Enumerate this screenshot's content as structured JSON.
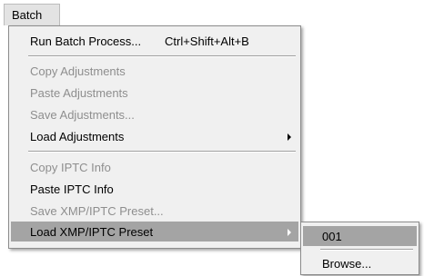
{
  "menubar": {
    "batch_label": "Batch"
  },
  "menu": {
    "run_batch_label": "Run Batch Process...",
    "run_batch_shortcut": "Ctrl+Shift+Alt+B",
    "copy_adjustments_label": "Copy Adjustments",
    "paste_adjustments_label": "Paste Adjustments",
    "save_adjustments_label": "Save Adjustments...",
    "load_adjustments_label": "Load Adjustments",
    "copy_iptc_label": "Copy IPTC Info",
    "paste_iptc_label": "Paste IPTC Info",
    "save_xmp_label": "Save XMP/IPTC Preset...",
    "load_xmp_label": "Load XMP/IPTC Preset"
  },
  "submenu": {
    "preset_001_label": "001",
    "browse_label": "Browse..."
  },
  "colors": {
    "menu_background": "#f0f0f0",
    "highlight": "#a4a4a4",
    "disabled_text": "#8e8e8e"
  }
}
